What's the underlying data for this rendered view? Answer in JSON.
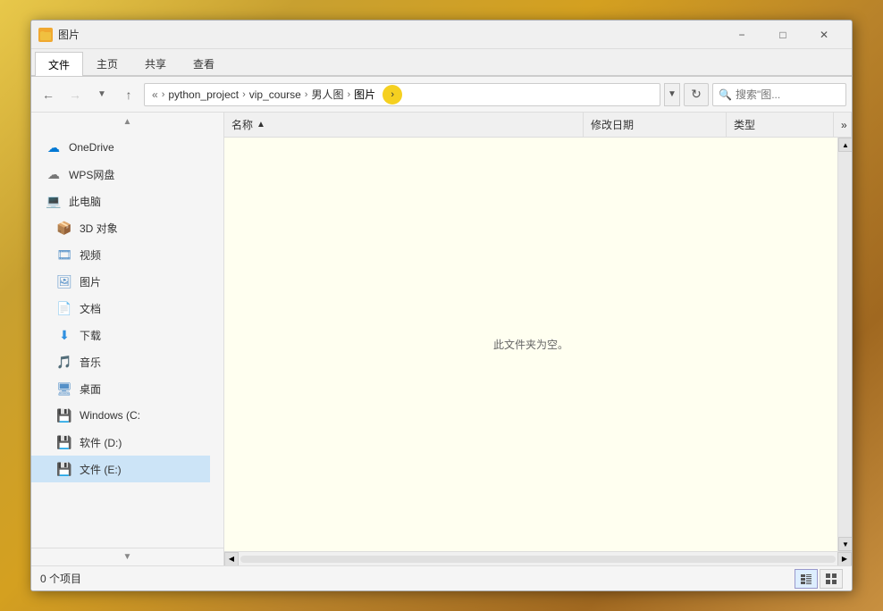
{
  "window": {
    "title": "图片",
    "icon": "📁"
  },
  "titlebar": {
    "minimize_label": "−",
    "maximize_label": "□",
    "close_label": "✕"
  },
  "ribbon": {
    "tabs": [
      {
        "id": "file",
        "label": "文件",
        "active": true
      },
      {
        "id": "home",
        "label": "主页",
        "active": false
      },
      {
        "id": "share",
        "label": "共享",
        "active": false
      },
      {
        "id": "view",
        "label": "查看",
        "active": false
      }
    ]
  },
  "addressbar": {
    "back_disabled": false,
    "forward_disabled": true,
    "up_disabled": false,
    "breadcrumb": [
      "python_project",
      "vip_course",
      "男人图",
      "图片"
    ],
    "refresh_symbol": "↻",
    "search_placeholder": "搜索\"图..."
  },
  "sidebar": {
    "items": [
      {
        "id": "onedrive",
        "label": "OneDrive",
        "icon": "☁"
      },
      {
        "id": "wps",
        "label": "WPS网盘",
        "icon": "☁"
      },
      {
        "id": "thispc",
        "label": "此电脑",
        "icon": "💻"
      },
      {
        "id": "3d",
        "label": "3D 对象",
        "icon": "📦"
      },
      {
        "id": "video",
        "label": "视频",
        "icon": "🎞"
      },
      {
        "id": "pictures",
        "label": "图片",
        "icon": "🖼"
      },
      {
        "id": "documents",
        "label": "文档",
        "icon": "📄"
      },
      {
        "id": "downloads",
        "label": "下载",
        "icon": "⬇"
      },
      {
        "id": "music",
        "label": "音乐",
        "icon": "🎵"
      },
      {
        "id": "desktop",
        "label": "桌面",
        "icon": "🖥"
      },
      {
        "id": "windows_c",
        "label": "Windows (C:",
        "icon": "💾"
      },
      {
        "id": "drive_d",
        "label": "软件 (D:)",
        "icon": "💾"
      },
      {
        "id": "drive_e",
        "label": "文件 (E:)",
        "icon": "💾"
      }
    ],
    "scroll_up": "▲",
    "scroll_down": "▼"
  },
  "filearea": {
    "columns": [
      {
        "id": "name",
        "label": "名称"
      },
      {
        "id": "date",
        "label": "修改日期"
      },
      {
        "id": "type",
        "label": "类型"
      }
    ],
    "empty_message": "此文件夹为空。"
  },
  "statusbar": {
    "item_count": "0 个项目",
    "view_list_label": "≡",
    "view_detail_label": "⊞"
  }
}
